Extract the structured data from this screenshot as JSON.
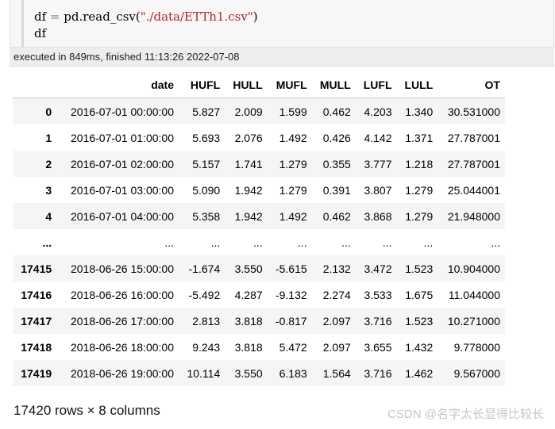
{
  "code_cell": {
    "line1": {
      "lhs": "df",
      "eq": " = ",
      "call": "pd.read_csv(",
      "arg": "\"./data/ETTh1.csv\"",
      "close": ")"
    },
    "line2": "df"
  },
  "execution_info": "executed in 849ms, finished 11:13:26 2022-07-08",
  "dataframe": {
    "columns": [
      "date",
      "HUFL",
      "HULL",
      "MUFL",
      "MULL",
      "LUFL",
      "LULL",
      "OT"
    ],
    "rows": [
      {
        "index": "0",
        "cells": [
          "2016-07-01 00:00:00",
          "5.827",
          "2.009",
          "1.599",
          "0.462",
          "4.203",
          "1.340",
          "30.531000"
        ]
      },
      {
        "index": "1",
        "cells": [
          "2016-07-01 01:00:00",
          "5.693",
          "2.076",
          "1.492",
          "0.426",
          "4.142",
          "1.371",
          "27.787001"
        ]
      },
      {
        "index": "2",
        "cells": [
          "2016-07-01 02:00:00",
          "5.157",
          "1.741",
          "1.279",
          "0.355",
          "3.777",
          "1.218",
          "27.787001"
        ]
      },
      {
        "index": "3",
        "cells": [
          "2016-07-01 03:00:00",
          "5.090",
          "1.942",
          "1.279",
          "0.391",
          "3.807",
          "1.279",
          "25.044001"
        ]
      },
      {
        "index": "4",
        "cells": [
          "2016-07-01 04:00:00",
          "5.358",
          "1.942",
          "1.492",
          "0.462",
          "3.868",
          "1.279",
          "21.948000"
        ]
      },
      {
        "index": "...",
        "cells": [
          "...",
          "...",
          "...",
          "...",
          "...",
          "...",
          "...",
          "..."
        ]
      },
      {
        "index": "17415",
        "cells": [
          "2018-06-26 15:00:00",
          "-1.674",
          "3.550",
          "-5.615",
          "2.132",
          "3.472",
          "1.523",
          "10.904000"
        ]
      },
      {
        "index": "17416",
        "cells": [
          "2018-06-26 16:00:00",
          "-5.492",
          "4.287",
          "-9.132",
          "2.274",
          "3.533",
          "1.675",
          "11.044000"
        ]
      },
      {
        "index": "17417",
        "cells": [
          "2018-06-26 17:00:00",
          "2.813",
          "3.818",
          "-0.817",
          "2.097",
          "3.716",
          "1.523",
          "10.271000"
        ]
      },
      {
        "index": "17418",
        "cells": [
          "2018-06-26 18:00:00",
          "9.243",
          "3.818",
          "5.472",
          "2.097",
          "3.655",
          "1.432",
          "9.778000"
        ]
      },
      {
        "index": "17419",
        "cells": [
          "2018-06-26 19:00:00",
          "10.114",
          "3.550",
          "6.183",
          "1.564",
          "3.716",
          "1.462",
          "9.567000"
        ]
      }
    ],
    "shape_text": "17420 rows × 8 columns"
  },
  "watermark": "CSDN @名字太长显得比较长"
}
